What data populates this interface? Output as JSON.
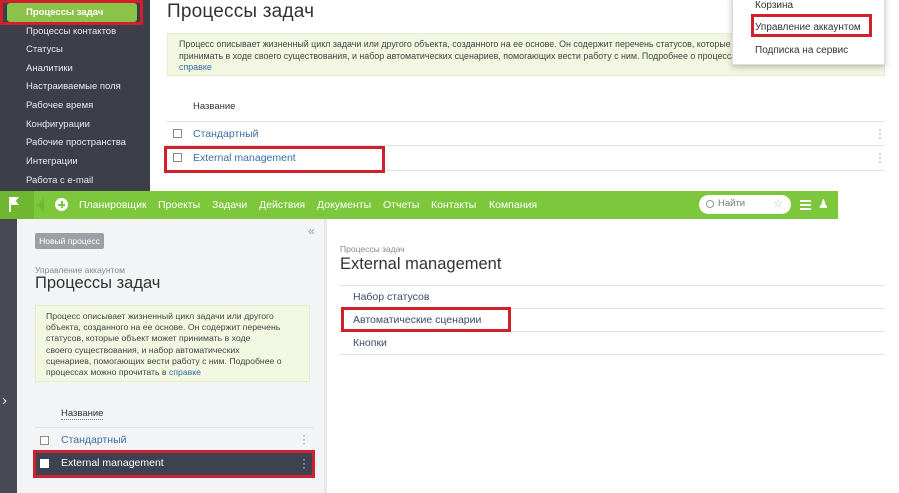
{
  "top": {
    "sidebar_items": [
      "Процессы задач",
      "Процессы контактов",
      "Статусы",
      "Аналитики",
      "Настраиваемые поля",
      "Рабочее время",
      "Конфигурации",
      "Рабочие пространства",
      "Интеграции",
      "Работа с e-mail"
    ],
    "title": "Процессы задач",
    "info_text": "Процесс описывает жизненный цикл задачи или другого объекта, созданного на ее основе. Он содержит перечень статусов, которые объект может",
    "info_text_2": "принимать в ходе своего существования, и набор автоматических сценариев, помогающих вести работу с ним. Подробнее о процессах можно прочитать в",
    "info_link": "справке",
    "column_header": "Название",
    "rows": [
      "Стандартный",
      "External management"
    ],
    "dropdown": [
      "Корзина",
      "Управление аккаунтом",
      "Подписка на сервис"
    ]
  },
  "nav": {
    "items": [
      "Планировщик",
      "Проекты",
      "Задачи",
      "Действия",
      "Документы",
      "Отчеты",
      "Контакты",
      "Компания"
    ],
    "search_placeholder": "Найти"
  },
  "left_panel": {
    "new_button": "Новый процесс",
    "breadcrumb": "Управление аккаунтом",
    "title": "Процессы задач",
    "collapse_glyph": "«",
    "info_lines": [
      "Процесс описывает жизненный цикл задачи или другого",
      "объекта, созданного на ее основе. Он содержит перечень",
      "статусов, которые объект может принимать в ходе",
      "своего существования, и набор автоматических",
      "сценариев, помогающих вести работу с ним. Подробнее о",
      "процессах можно прочитать в "
    ],
    "info_link": "справке",
    "column_header": "Название",
    "rows": [
      "Стандартный",
      "External management"
    ]
  },
  "right_panel": {
    "breadcrumb": "Процессы задач",
    "title": "External management",
    "tabs": [
      "Набор статусов",
      "Автоматические сценарии",
      "Кнопки"
    ]
  },
  "colors": {
    "accent_green": "#7dc73c",
    "highlight_red": "#d0202d",
    "sidebar_dark": "#3c3f4a"
  }
}
